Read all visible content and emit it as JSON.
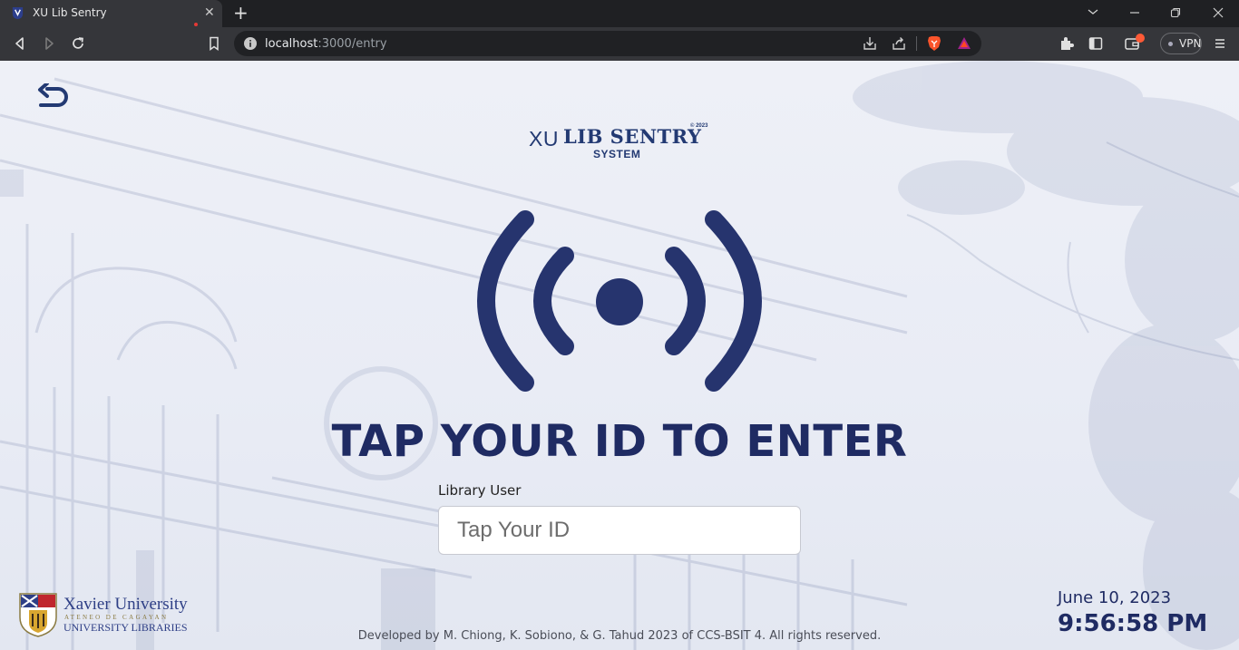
{
  "browser": {
    "tab_title": "XU Lib Sentry",
    "url_host": "localhost",
    "url_path": ":3000/entry",
    "vpn_label": "VPN",
    "new_tab_symbol": "+",
    "close_symbol": "✕"
  },
  "page": {
    "logo": {
      "prefix": "XU",
      "name": "LIB SENTRY",
      "copyright": "© 2023",
      "subtitle": "SYSTEM"
    },
    "headline": "TAP YOUR ID TO ENTER",
    "field_label": "Library User",
    "input_placeholder": "Tap Your ID",
    "input_value": "",
    "university": {
      "name": "Xavier University",
      "sub": "ATENEO DE CAGAYAN",
      "department": "UNIVERSITY LIBRARIES"
    },
    "footer": "Developed by M. Chiong, K. Sobiono, & G. Tahud 2023 of CCS-BSIT 4. All rights reserved.",
    "date": "June 10, 2023",
    "time": "9:56:58 PM"
  },
  "colors": {
    "primary": "#233a73",
    "headline": "#1f2b63",
    "rfid_icon": "#26346e",
    "chrome_dark": "#1f2023",
    "chrome_toolbar": "#35363a"
  },
  "icons": [
    "back-arrow-icon",
    "rfid-signal-icon",
    "reload-icon",
    "bookmark-icon",
    "info-icon",
    "download-icon",
    "share-icon",
    "brave-shield-icon",
    "rewards-icon",
    "extensions-icon",
    "sidebar-icon",
    "wallet-icon",
    "menu-icon"
  ]
}
